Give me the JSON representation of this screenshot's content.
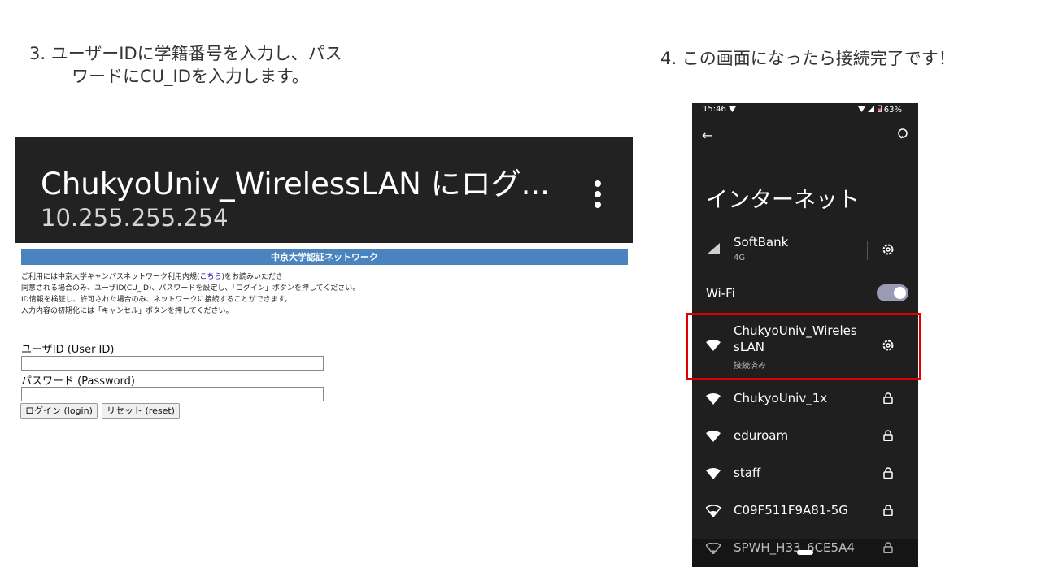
{
  "step3": {
    "line1": "3. ユーザーIDに学籍番号を入力し、パス",
    "line2": "ワードにCU_IDを入力します。"
  },
  "step4": {
    "text": "4. この画面になったら接続完了です！"
  },
  "browser": {
    "title": "ChukyoUniv_WirelessLAN にログ...",
    "url": "10.255.255.254",
    "banner": "中京大学認証ネットワーク",
    "notice": {
      "l1a": "ご利用には中京大学キャンパスネットワーク利用内規(",
      "l1link": "こちら",
      "l1b": ")をお読みいただき",
      "l2": "同意される場合のみ、ユーザID(CU_ID)、パスワードを設定し、「ログイン」ボタンを押してください。",
      "l3": "ID情報を検証し、許可された場合のみ、ネットワークに接続することができます。",
      "l4": "入力内容の初期化には「キャンセル」ボタンを押してください。"
    },
    "userid_label": "ユーザID (User ID)",
    "userid_value": "",
    "password_label": "パスワード (Password)",
    "password_value": "",
    "login_button": "ログイン (login)",
    "reset_button": "リセット (reset)"
  },
  "phone": {
    "time": "15:46",
    "battery": "63%",
    "title": "インターネット",
    "carrier": {
      "name": "SoftBank",
      "sub": "4G"
    },
    "wifi_label": "Wi-Fi",
    "wifi_on": true,
    "connected": {
      "name1": "ChukyoUniv_Wireles",
      "name2": "sLAN",
      "status": "接続済み"
    },
    "networks": [
      {
        "name": "ChukyoUniv_1x"
      },
      {
        "name": "eduroam"
      },
      {
        "name": "staff"
      },
      {
        "name": "C09F511F9A81-5G"
      },
      {
        "name": "SPWH_H33_6CE5A4"
      }
    ]
  },
  "colors": {
    "highlight": "#e10000",
    "banner": "#4a84bf"
  }
}
